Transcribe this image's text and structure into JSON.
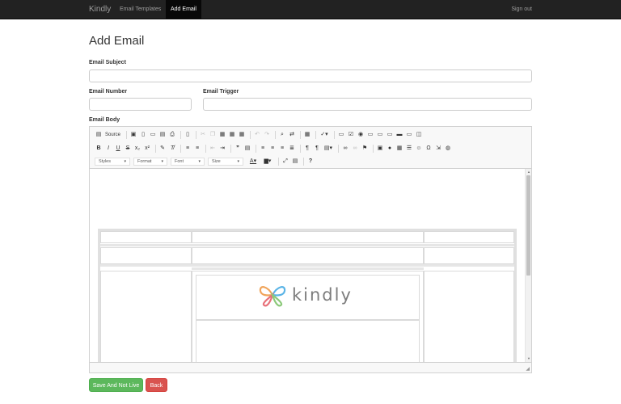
{
  "navbar": {
    "brand": "Kindly",
    "links": [
      {
        "label": "Email Templates"
      },
      {
        "label": "Add Email"
      }
    ],
    "signout": "Sign out"
  },
  "page": {
    "title": "Add Email"
  },
  "form": {
    "subject_label": "Email Subject",
    "subject_value": "",
    "number_label": "Email Number",
    "number_value": "",
    "trigger_label": "Email Trigger",
    "trigger_value": "",
    "body_label": "Email Body"
  },
  "editor": {
    "source_label": "Source",
    "combos": [
      {
        "label": "Styles"
      },
      {
        "label": "Format"
      },
      {
        "label": "Font"
      },
      {
        "label": "Size"
      }
    ],
    "help": "?"
  },
  "content": {
    "logo_text": "kindly"
  },
  "buttons": {
    "save": "Save And Not Live",
    "back": "Back"
  },
  "colors": {
    "navbar": "#222222",
    "success": "#5cb85c",
    "danger": "#d9534f",
    "logo_orange": "#f0a45a",
    "logo_blue": "#5ab4e6",
    "logo_red": "#e8717a"
  }
}
